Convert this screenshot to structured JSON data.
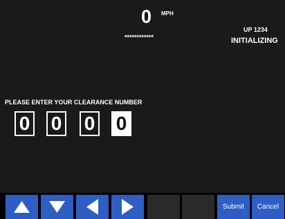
{
  "status": {
    "speed": "0",
    "speed_unit": "MPH",
    "masked_field": "************",
    "train_id": "UP 1234",
    "state": "INITIALIZING"
  },
  "clearance": {
    "prompt": "PLEASE ENTER YOUR CLEARANCE NUMBER",
    "digits": [
      "0",
      "0",
      "0",
      "0"
    ],
    "active_index": 3
  },
  "buttons": {
    "up_icon": "triangle-up-icon",
    "down_icon": "triangle-down-icon",
    "left_icon": "triangle-left-icon",
    "right_icon": "triangle-right-icon",
    "submit": "Submit",
    "cancel": "Cancel"
  },
  "colors": {
    "background": "#1a1a1a",
    "button": "#2e5ec4",
    "button_empty": "#2a2a2a",
    "text": "#ffffff"
  }
}
